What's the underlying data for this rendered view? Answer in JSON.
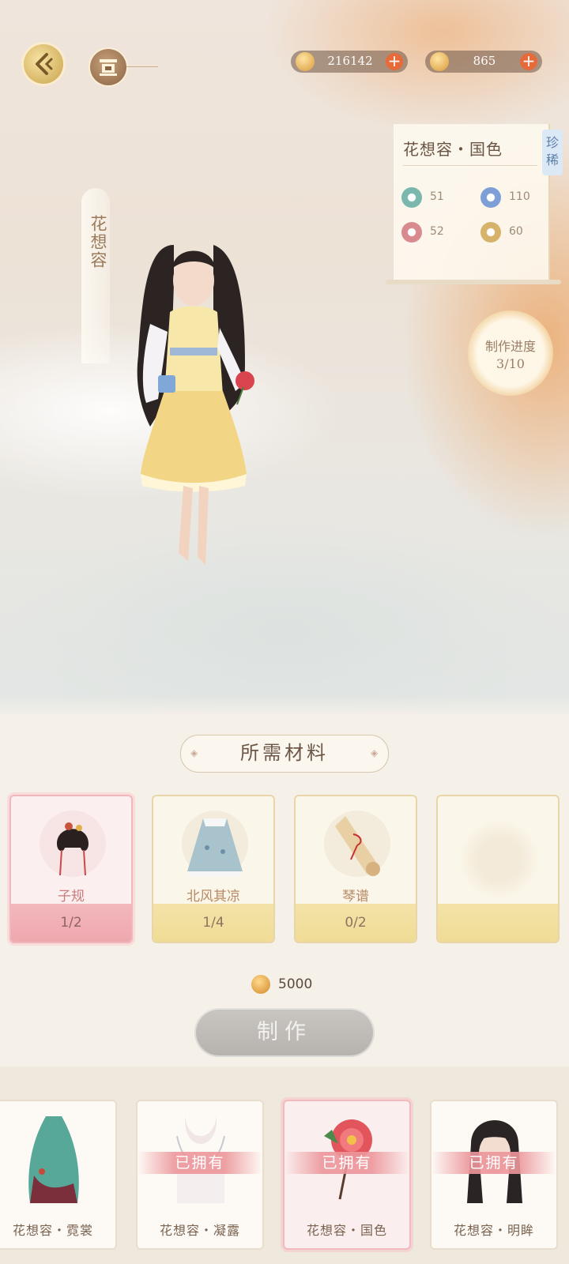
{
  "header": {
    "currencies": [
      {
        "icon": "gold-coin-icon",
        "value": "216142"
      },
      {
        "icon": "jade-coin-icon",
        "value": "865"
      }
    ]
  },
  "character": {
    "vertical_name": "花想容"
  },
  "info_card": {
    "title": "花想容・国色",
    "rarity": "珍稀",
    "stats": [
      {
        "icon": "leaf-swirl-icon",
        "value": "51",
        "color": "#7bb7ad"
      },
      {
        "icon": "snowflake-icon",
        "value": "110",
        "color": "#7e9ed6"
      },
      {
        "icon": "lotus-icon",
        "value": "52",
        "color": "#d98a8e"
      },
      {
        "icon": "moon-icon",
        "value": "60",
        "color": "#d6b26a"
      }
    ]
  },
  "progress": {
    "label": "制作进度",
    "value": "3/10"
  },
  "materials": {
    "title": "所需材料",
    "items": [
      {
        "name": "子规",
        "count": "1/2",
        "style": "pink"
      },
      {
        "name": "北风其凉",
        "count": "1/4",
        "style": "yellow"
      },
      {
        "name": "琴谱",
        "count": "0/2",
        "style": "yellow"
      },
      {
        "name": "",
        "count": "",
        "style": "yellow"
      }
    ]
  },
  "cost": {
    "value": "5000"
  },
  "make_button": {
    "label": "制作"
  },
  "outfits": [
    {
      "name": "花想容・霓裳",
      "owned": ""
    },
    {
      "name": "花想容・凝露",
      "owned": "已拥有"
    },
    {
      "name": "花想容・国色",
      "owned": "已拥有"
    },
    {
      "name": "花想容・明眸",
      "owned": "已拥有"
    }
  ],
  "colors": {
    "accent_pink": "#f2b6bd",
    "accent_gold": "#e8d6a8",
    "button_gray": "#bdb9b5"
  }
}
